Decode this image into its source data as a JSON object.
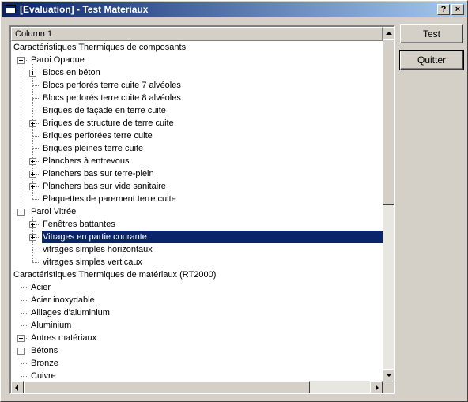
{
  "window": {
    "title": "[Evaluation] - Test Materiaux",
    "help_label": "?",
    "close_label": "×"
  },
  "tree": {
    "column_header": "Column 1",
    "rows": [
      {
        "label": "Caractéristiques Thermiques de composants",
        "level": 0,
        "expander": "none"
      },
      {
        "label": "Paroi Opaque",
        "level": 1,
        "expander": "minus"
      },
      {
        "label": "Blocs en béton",
        "level": 2,
        "expander": "plus"
      },
      {
        "label": "Blocs perforés terre cuite 7 alvéoles",
        "level": 2,
        "expander": "none"
      },
      {
        "label": "Blocs perforés terre cuite 8 alvéoles",
        "level": 2,
        "expander": "none"
      },
      {
        "label": "Briques de façade en terre cuite",
        "level": 2,
        "expander": "none"
      },
      {
        "label": "Briques de structure de terre cuite",
        "level": 2,
        "expander": "plus"
      },
      {
        "label": "Briques perforées terre cuite",
        "level": 2,
        "expander": "none"
      },
      {
        "label": "Briques pleines terre cuite",
        "level": 2,
        "expander": "none"
      },
      {
        "label": "Planchers à entrevous",
        "level": 2,
        "expander": "plus"
      },
      {
        "label": "Planchers bas sur terre-plein",
        "level": 2,
        "expander": "plus"
      },
      {
        "label": "Planchers bas sur vide sanitaire",
        "level": 2,
        "expander": "plus"
      },
      {
        "label": "Plaquettes de parement terre cuite",
        "level": 2,
        "expander": "none"
      },
      {
        "label": "Paroi Vitrée",
        "level": 1,
        "expander": "minus"
      },
      {
        "label": "Fenêtres battantes",
        "level": 2,
        "expander": "plus"
      },
      {
        "label": "Vitrages en partie courante",
        "level": 2,
        "expander": "plus",
        "selected": true
      },
      {
        "label": "vitrages simples horizontaux",
        "level": 2,
        "expander": "none"
      },
      {
        "label": "vitrages simples verticaux",
        "level": 2,
        "expander": "none"
      },
      {
        "label": "Caractéristiques Thermiques de matériaux (RT2000)",
        "level": 0,
        "expander": "none"
      },
      {
        "label": "Acier",
        "level": 1,
        "expander": "none"
      },
      {
        "label": "Acier inoxydable",
        "level": 1,
        "expander": "none"
      },
      {
        "label": "Alliages d'aluminium",
        "level": 1,
        "expander": "none"
      },
      {
        "label": "Aluminium",
        "level": 1,
        "expander": "none"
      },
      {
        "label": "Autres matériaux",
        "level": 1,
        "expander": "plus"
      },
      {
        "label": "Bétons",
        "level": 1,
        "expander": "plus"
      },
      {
        "label": "Bronze",
        "level": 1,
        "expander": "none"
      },
      {
        "label": "Cuivre",
        "level": 1,
        "expander": "none"
      }
    ]
  },
  "buttons": {
    "test_label": "Test",
    "quit_label": "Quitter"
  },
  "colors": {
    "selection": "#0a246a",
    "face": "#d4d0c8"
  }
}
